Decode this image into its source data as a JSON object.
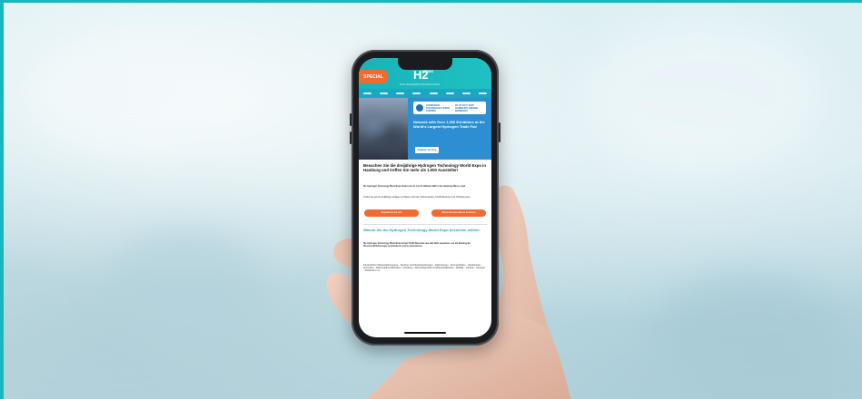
{
  "email": {
    "special_label": "SPECIAL",
    "logo": "H2",
    "logo_news": "NEWS",
    "tagline": "DAS WASSERSTOFFMAGAZIN",
    "banner_logo_text": "HYDROGEN TECHNOLOGY EXPO EUROPE",
    "banner_date": "22-23 OCT 2025 HAMBURG MESSE GERMANY",
    "banner_text": "Network with Over 1,000 Exhibitors at the World's Largest Hydrogen Trade Fair",
    "banner_button": "Register for Free",
    "headline": "Besuchen Sie die dreijährige Hydrogen Technology World Expo in Hamburg und treffen Sie mehr als 1.000 Aussteller!",
    "para1": "Die Hydrogen Technology World Expo findet vom 21. bis 23. Oktober 2025 in der Hamburg Messe, statt.",
    "para2": "Treffen Sie auf der dreijährigen Auflage und Messe mehr als 1.000 Aussteller, 15.000 Besucher und 700 Referenten.",
    "cta1": "Registrieren Sie sich",
    "cta2": "Warum Sie diese Messe besuchen",
    "subheading": "Warum Sie die Hydrogen Technology World Expo besuchen sollten:",
    "para3": "Die Hydrogen Technology World Expo bringt 15.000 Besucher aus aller Welt zusammen, um die Nutzung der Wasserstofftechnologie zu diskutieren und zu präsentieren.",
    "para4": "Industrieführer Wasserstofferzeugung – Speicher und Infrastrukturlösungen – Elektrolyseure – Brennstoffzellen – Netzbetreiber – Automotive – Wasserstoff aus Biomasse – Verteilung – Sicherheitstechnik und Wasserstoffantrieb – Mobilität – Industrie – Netzwerk – Sicherheit u.v.m."
  },
  "colors": {
    "border": "#16b7bd",
    "header": "#18b3b8",
    "accent_orange": "#f26a2e",
    "banner_blue": "#2d8fd1"
  }
}
